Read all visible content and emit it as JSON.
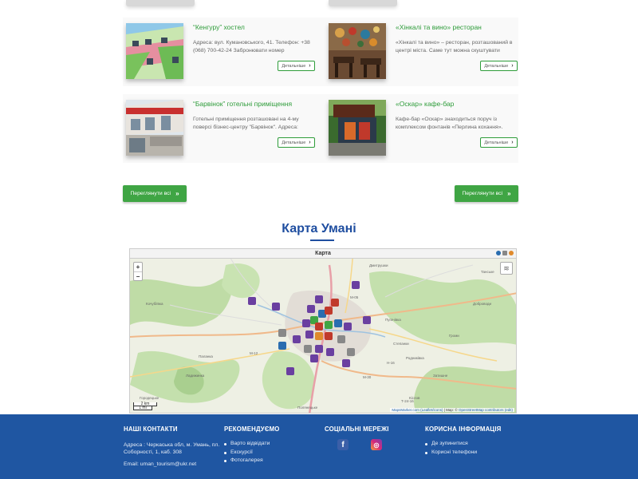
{
  "listings": [
    {
      "title": "“Кенгуру” хостел",
      "text": "Адреса: вул. Кумановського, 41. Телефон: +38 (068) 700-42-24 Забронювати номер",
      "button": "Детальніше"
    },
    {
      "title": "«Хінкалі та вино» ресторан",
      "text": "«Хінкалі та вино» – ресторан, розташований в центрі міста. Саме тут можна скуштувати",
      "button": "Детальніше"
    },
    {
      "title": "“Барвінок” готельні приміщення",
      "text": "Готельні приміщення розташовані на 4-му поверсі бізнес-центру \"Барвінок\". Адреса:",
      "button": "Детальніше"
    },
    {
      "title": "«Оскар» кафе-бар",
      "text": "Кафе-бар «Оскар» знаходиться поруч із комплексом фонтанів «Перлина кохання».",
      "button": "Детальніше"
    }
  ],
  "view_all_left": "Переглянути всі",
  "view_all_right": "Переглянути всі",
  "map_section_title": "Карта Умані",
  "map": {
    "window_title": "Карта",
    "zoom_in": "+",
    "zoom_out": "−",
    "scale_km": "2 km",
    "scale_mi": "1 mi",
    "attribution_1": "MapsMarker.com (Leaflet/icons)",
    "attribution_2": " | Map: © ",
    "attribution_3": "OpenStreetMap contributors (edit)",
    "labels": [
      "Дмитрушки",
      "Танське",
      "Доброводи",
      "Кочубіївка",
      "Паланка",
      "Ладижинка",
      "Городецьке",
      "Родниківка",
      "Полянецьке",
      "Затишне",
      "Громи",
      "Пугачівка",
      "Степанки",
      "Кіслов",
      "М-05",
      "М-12",
      "М-30",
      "Т-24-16",
      "Н-16"
    ]
  },
  "footer": {
    "contacts_title": "НАШІ КОНТАКТИ",
    "address": "Адреса : Черкаська обл, м. Умань, пл. Соборності, 1, каб. 308",
    "email": "Email: uman_tourism@ukr.net",
    "recommend_title": "РЕКОМЕНДУЄМО",
    "recommend_items": [
      "Варто відвідати",
      "Екскурсії",
      "Фотогалерея"
    ],
    "social_title": "СОЦІАЛЬНІ МЕРЕЖІ",
    "useful_title": "КОРИСНА ІНФОРМАЦІЯ",
    "useful_items": [
      "Де зупинитися",
      "Корисні телефони"
    ]
  },
  "colors": {
    "accent_green": "#2e9c3a",
    "button_green": "#3fa544",
    "brand_blue": "#1f56a2",
    "heading_blue": "#1f4ea0"
  }
}
